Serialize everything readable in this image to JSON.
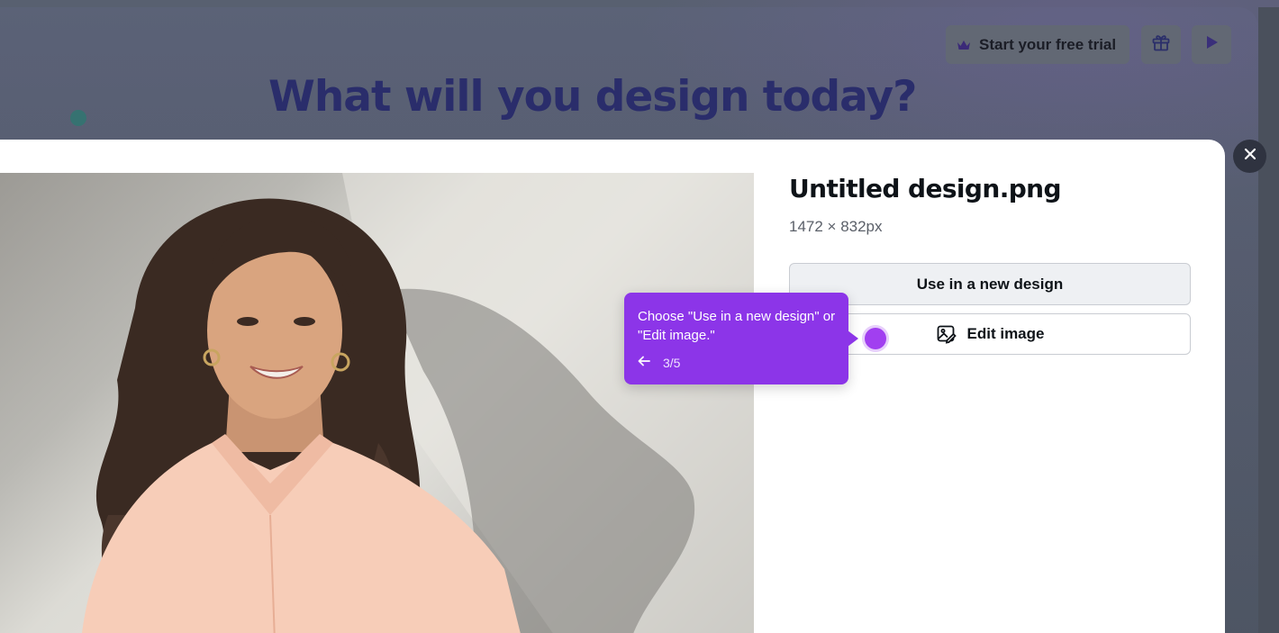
{
  "background": {
    "heading": "What will you design today?",
    "header_buttons": {
      "trial_label": "Start your free trial"
    }
  },
  "modal": {
    "file_title": "Untitled design.png",
    "dimensions": "1472 × 832px",
    "actions": {
      "use_in_new_design": "Use in a new design",
      "edit_image": "Edit image"
    }
  },
  "guide": {
    "text": "Choose \"Use in a new design\" or \"Edit image.\"",
    "step": "3/5"
  },
  "colors": {
    "accent": "#8c35e8",
    "overlay": "#4d5563"
  },
  "icons": [
    "crown-icon",
    "gift-icon",
    "play-icon",
    "close-icon",
    "image-edit-icon",
    "arrow-left-icon"
  ]
}
